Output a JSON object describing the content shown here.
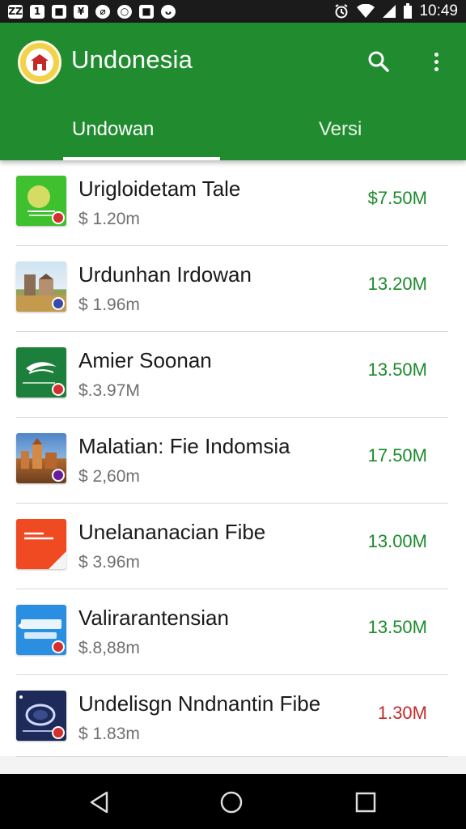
{
  "status_bar": {
    "notif_icons": [
      "ZZ",
      "1",
      "■",
      "¥",
      "⌀",
      "○",
      "■",
      "ᴗ"
    ],
    "time": "10:49"
  },
  "app_bar": {
    "title": "Undonesia",
    "tabs": [
      {
        "label": "Undowan",
        "selected": true
      },
      {
        "label": "Versi",
        "selected": false
      }
    ]
  },
  "items": [
    {
      "title": "Urigloidetam Tale",
      "subtitle": "$ 1.20m",
      "value": "$7.50M",
      "value_color": "#1c8a2c",
      "thumb_icon": "green-seal-icon"
    },
    {
      "title": "Urdunhan Irdowan",
      "subtitle": "$ 1.96m",
      "value": "13.20M",
      "value_color": "#1c8a2c",
      "thumb_icon": "building-photo-icon"
    },
    {
      "title": "Amier Soonan",
      "subtitle": "$.3.97M",
      "value": "13.50M",
      "value_color": "#1c8a2c",
      "thumb_icon": "green-wing-logo-icon"
    },
    {
      "title": "Malatian: Fie Indomsia",
      "subtitle": "$ 2,60m",
      "value": "17.50M",
      "value_color": "#1c8a2c",
      "thumb_icon": "city-photo-icon"
    },
    {
      "title": "Unelananacian Fibe",
      "subtitle": "$ 3.96m",
      "value": "13.00M",
      "value_color": "#1c8a2c",
      "thumb_icon": "orange-card-icon"
    },
    {
      "title": "Valirarantensian",
      "subtitle": "$.8,88m",
      "value": "13.50M",
      "value_color": "#1c8a2c",
      "thumb_icon": "blue-card-icon"
    },
    {
      "title": "Undelisgn Nndnantin Fibe",
      "subtitle": "$ 1.83m",
      "value": "1.30M",
      "value_color": "#c62828",
      "thumb_icon": "dark-card-icon"
    }
  ],
  "colors": {
    "app_bar": "#218c2f",
    "value_green": "#1c8a2c",
    "value_red": "#c62828"
  }
}
